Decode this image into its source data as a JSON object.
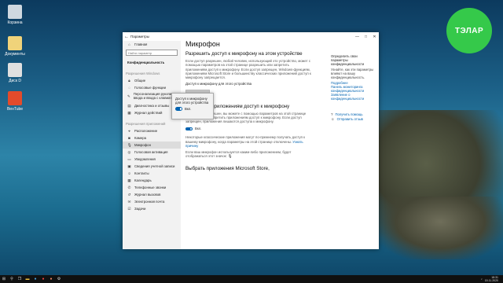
{
  "desktop": {
    "icons": [
      {
        "label": "Корзина"
      },
      {
        "label": "Документы"
      },
      {
        "label": "Диск D"
      },
      {
        "label": "ВенTube"
      }
    ],
    "brand_text": "ТЭЛАР"
  },
  "window": {
    "title": "Параметры",
    "controls": [
      "—",
      "□",
      "✕"
    ]
  },
  "sidebar": {
    "home": "Главная",
    "search_placeholder": "Найти параметр",
    "privacy_title": "Конфиденциальность",
    "windows_permissions_header": "Разрешения Windows",
    "windows_items": [
      {
        "label": "Общие",
        "icon": "lock-icon"
      },
      {
        "label": "Голосовые функции",
        "icon": "voice-icon"
      },
      {
        "label": "Персонализация рукописного ввода и ввода с клавиатуры",
        "icon": "pen-icon"
      },
      {
        "label": "Диагностика и отзывы",
        "icon": "diagnostics-icon"
      },
      {
        "label": "Журнал действий",
        "icon": "activity-icon"
      }
    ],
    "app_permissions_header": "Разрешения приложений",
    "app_items": [
      {
        "label": "Расположение",
        "icon": "location-icon"
      },
      {
        "label": "Камера",
        "icon": "camera-icon"
      },
      {
        "label": "Микрофон",
        "icon": "microphone-icon"
      },
      {
        "label": "Голосовая активация",
        "icon": "voice-activation-icon"
      },
      {
        "label": "Уведомления",
        "icon": "bell-icon"
      },
      {
        "label": "Сведения учетной записи",
        "icon": "account-icon"
      },
      {
        "label": "Контакты",
        "icon": "contacts-icon"
      },
      {
        "label": "Календарь",
        "icon": "calendar-icon"
      },
      {
        "label": "Телефонные звонки",
        "icon": "phone-icon"
      },
      {
        "label": "Журнал вызовов",
        "icon": "call-history-icon"
      },
      {
        "label": "Электронная почта",
        "icon": "mail-icon"
      },
      {
        "label": "Задачи",
        "icon": "tasks-icon"
      }
    ]
  },
  "main": {
    "page_title": "Микрофон",
    "section1": {
      "heading": "Разрешить доступ к микрофону на этом устройстве",
      "body": "Если доступ разрешен, любой человек, использующий это устройство, может с помощью параметров на этой странице разрешить или запретить приложениям доступ к микрофону. Если доступ запрещен, Windows-функциям, приложениям Microsoft Store и большинству классических приложений доступ к микрофону запрещается.",
      "status": "Доступ к микрофону для этого устройства",
      "button": "Изменить"
    },
    "section2": {
      "heading": "Разрешить приложениям доступ к микрофону",
      "body": "Если доступ разрешен, вы можете с помощью параметров на этой странице разрешить или запретить приложениям доступ к микрофону. Если доступ запрещен, приложения лишаются доступа к микрофону.",
      "toggle_label": "Вкл.",
      "note1": "Некоторые классические приложения могут по-прежнему получать доступ к вашему микрофону, когда параметры на этой странице отключены.",
      "note1_link": "Узнать причину",
      "note2": "Если ваш микрофон используется каким-либо приложением, будет отображаться этот значок:"
    },
    "section3": {
      "heading": "Выбрать приложения Microsoft Store,"
    }
  },
  "popup": {
    "title": "Доступ к микрофону для этого устройства",
    "toggle_label": "Вкл."
  },
  "right": {
    "intro": "Определить свои параметры конфиденциальности",
    "body": "Узнайте, как эти параметры влияют на вашу конфиденциальность.",
    "links": [
      "Подробнее",
      "Панель мониторинга конфиденциальности",
      "Заявление о конфиденциальности"
    ],
    "help": "Получить помощь",
    "feedback": "Отправить отзыв"
  },
  "taskbar": {
    "time": "18:31",
    "date": "15.11.2020"
  },
  "colors": {
    "accent": "#0063b1",
    "brand": "#35c94a"
  }
}
